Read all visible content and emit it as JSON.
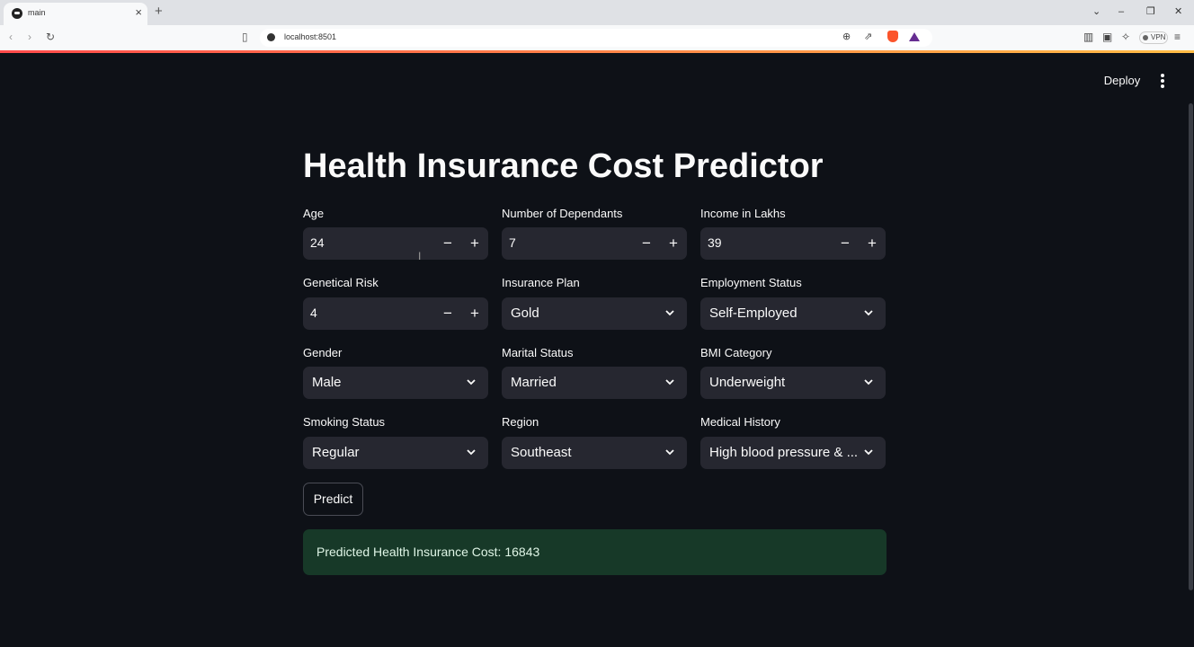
{
  "browser": {
    "tab_title": "main",
    "url": "localhost:8501",
    "vpn_label": "VPN"
  },
  "app": {
    "deploy_label": "Deploy",
    "title": "Health Insurance Cost Predictor",
    "fields": {
      "age": {
        "label": "Age",
        "value": "24"
      },
      "dependants": {
        "label": "Number of Dependants",
        "value": "7"
      },
      "income": {
        "label": "Income in Lakhs",
        "value": "39"
      },
      "genetical_risk": {
        "label": "Genetical Risk",
        "value": "4"
      },
      "insurance_plan": {
        "label": "Insurance Plan",
        "value": "Gold"
      },
      "employment_status": {
        "label": "Employment Status",
        "value": "Self-Employed"
      },
      "gender": {
        "label": "Gender",
        "value": "Male"
      },
      "marital_status": {
        "label": "Marital Status",
        "value": "Married"
      },
      "bmi_category": {
        "label": "BMI Category",
        "value": "Underweight"
      },
      "smoking_status": {
        "label": "Smoking Status",
        "value": "Regular"
      },
      "region": {
        "label": "Region",
        "value": "Southeast"
      },
      "medical_history": {
        "label": "Medical History",
        "value": "High blood pressure & ..."
      }
    },
    "predict_label": "Predict",
    "result_text": "Predicted Health Insurance Cost: 16843"
  },
  "icons": {
    "minus": "−",
    "plus": "+"
  },
  "colors": {
    "background": "#0e1117",
    "input_bg": "#262730",
    "success_bg": "#173928",
    "accent_red": "#ff4b4b",
    "accent_yellow": "#ffbd45"
  }
}
